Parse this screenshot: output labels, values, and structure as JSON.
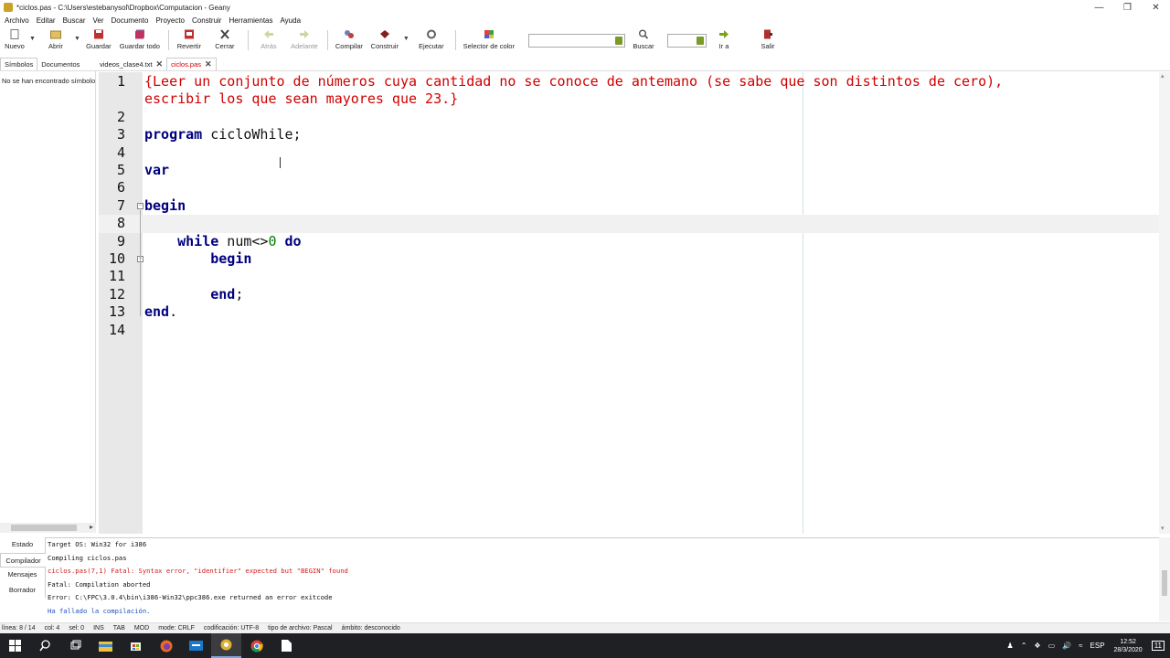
{
  "window": {
    "title": "*ciclos.pas - C:\\Users\\estebanysol\\Dropbox\\Computacion - Geany"
  },
  "menu": [
    "Archivo",
    "Editar",
    "Buscar",
    "Ver",
    "Documento",
    "Proyecto",
    "Construir",
    "Herramientas",
    "Ayuda"
  ],
  "toolbar": {
    "nuevo": "Nuevo",
    "abrir": "Abrir",
    "guardar": "Guardar",
    "guardar_todo": "Guardar todo",
    "revertir": "Revertir",
    "cerrar": "Cerrar",
    "atras": "Atrás",
    "adelante": "Adelante",
    "compilar": "Compilar",
    "construir": "Construir",
    "ejecutar": "Ejecutar",
    "selector_color": "Selector de color",
    "buscar": "Buscar",
    "ir_a": "Ir a",
    "salir": "Salir"
  },
  "sidebar": {
    "tabs": [
      "Símbolos",
      "Documentos"
    ],
    "empty_message": "No se han encontrado símbolos"
  },
  "doc_tabs": [
    {
      "label": "videos_clase4.txt",
      "active": false
    },
    {
      "label": "ciclos.pas",
      "active": true
    }
  ],
  "editor": {
    "current_line": 8,
    "lines": [
      {
        "n": "1",
        "parts": [
          {
            "t": "{Leer un conjunto de números cuya cantidad no se conoce de antemano (se sabe que son distintos de cero),",
            "c": "cm"
          }
        ]
      },
      {
        "n": "",
        "parts": [
          {
            "t": "escribir los que sean mayores que 23.}",
            "c": "cm"
          }
        ]
      },
      {
        "n": "2",
        "parts": []
      },
      {
        "n": "3",
        "parts": [
          {
            "t": "program",
            "c": "kw"
          },
          {
            "t": " cicloWhile;",
            "c": ""
          }
        ]
      },
      {
        "n": "4",
        "parts": []
      },
      {
        "n": "5",
        "parts": [
          {
            "t": "var",
            "c": "kw"
          }
        ]
      },
      {
        "n": "6",
        "parts": []
      },
      {
        "n": "7",
        "parts": [
          {
            "t": "begin",
            "c": "kw"
          }
        ]
      },
      {
        "n": "8",
        "parts": []
      },
      {
        "n": "9",
        "parts": [
          {
            "t": "    ",
            "c": ""
          },
          {
            "t": "while",
            "c": "kw"
          },
          {
            "t": " num<>",
            "c": ""
          },
          {
            "t": "0",
            "c": "nm"
          },
          {
            "t": " ",
            "c": ""
          },
          {
            "t": "do",
            "c": "kw"
          }
        ]
      },
      {
        "n": "10",
        "parts": [
          {
            "t": "        ",
            "c": ""
          },
          {
            "t": "begin",
            "c": "kw"
          }
        ]
      },
      {
        "n": "11",
        "parts": []
      },
      {
        "n": "12",
        "parts": [
          {
            "t": "        ",
            "c": ""
          },
          {
            "t": "end",
            "c": "kw"
          },
          {
            "t": ";",
            "c": ""
          }
        ]
      },
      {
        "n": "13",
        "parts": [
          {
            "t": "end",
            "c": "kw"
          },
          {
            "t": ".",
            "c": ""
          }
        ]
      },
      {
        "n": "14",
        "parts": []
      }
    ]
  },
  "message_tabs": [
    "Estado",
    "Compilador",
    "Mensajes",
    "Borrador"
  ],
  "messages": [
    {
      "text": "Target OS: Win32 for i386",
      "c": "black"
    },
    {
      "text": "Compiling ciclos.pas",
      "c": "black"
    },
    {
      "text": "ciclos.pas(7,1) Fatal: Syntax error, \"identifier\" expected but \"BEGIN\" found",
      "c": "red"
    },
    {
      "text": "Fatal: Compilation aborted",
      "c": "black"
    },
    {
      "text": "Error: C:\\FPC\\3.0.4\\bin\\i386-Win32\\ppc386.exe returned an error exitcode",
      "c": "black"
    },
    {
      "text": "Ha fallado la compilación.",
      "c": "blue"
    }
  ],
  "status": [
    "línea: 8 / 14",
    "col: 4",
    "sel: 0",
    "INS",
    "TAB",
    "MOD",
    "mode: CRLF",
    "codificación: UTF-8",
    "tipo de archivo: Pascal",
    "ámbito: desconocido"
  ],
  "taskbar": {
    "lang": "ESP",
    "time": "12:52",
    "date": "28/3/2020",
    "notif": "11"
  }
}
